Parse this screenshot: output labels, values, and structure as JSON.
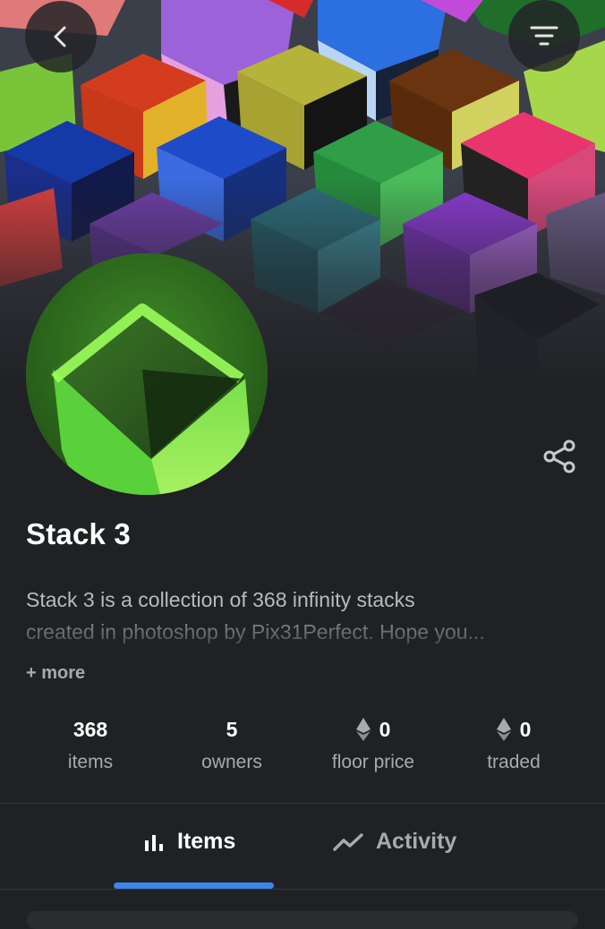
{
  "nav": {
    "back_icon": "chevron-left-icon",
    "filter_icon": "filter-icon"
  },
  "collection": {
    "name": "Stack 3",
    "description_line1": "Stack 3 is a collection of 368 infinity stacks",
    "description_line2": "created in photoshop by Pix31Perfect. Hope you...",
    "more_label": "+ more",
    "share_icon": "share-icon"
  },
  "stats": [
    {
      "value": "368",
      "label": "items",
      "eth": false
    },
    {
      "value": "5",
      "label": "owners",
      "eth": false
    },
    {
      "value": "0",
      "label": "floor price",
      "eth": true
    },
    {
      "value": "0",
      "label": "traded",
      "eth": true
    }
  ],
  "tabs": {
    "items_label": "Items",
    "activity_label": "Activity",
    "active": "Items"
  },
  "colors": {
    "background": "#202124",
    "accent": "#3d85e6",
    "muted_text": "#a9aaad",
    "avatar_green": "#7be04a"
  }
}
